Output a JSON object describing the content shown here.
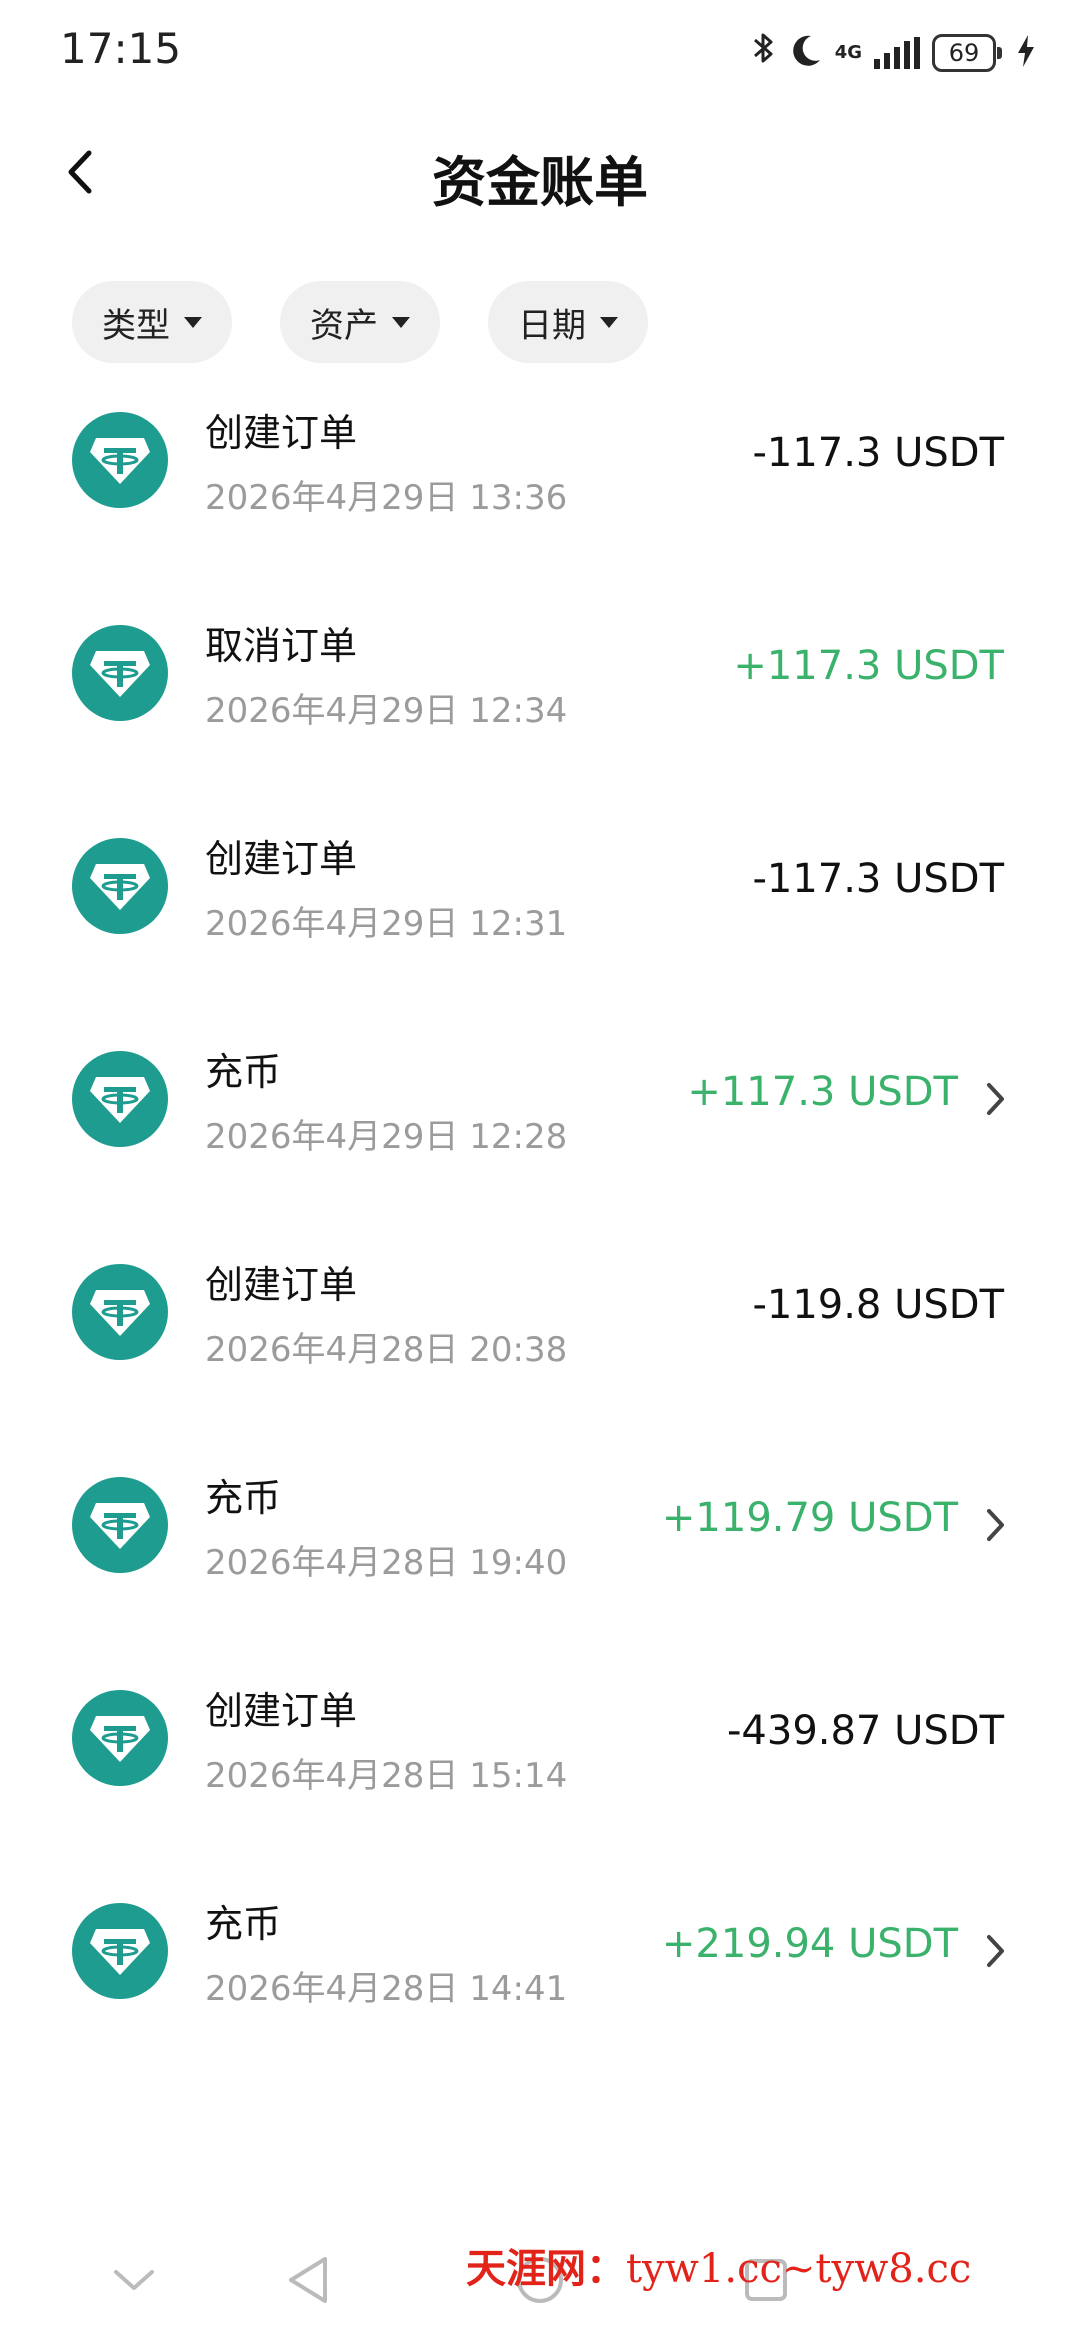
{
  "status_bar": {
    "time": "17:15",
    "network": "4G",
    "battery": "69"
  },
  "header": {
    "title": "资金账单"
  },
  "filters": [
    {
      "label": "类型"
    },
    {
      "label": "资产"
    },
    {
      "label": "日期"
    }
  ],
  "colors": {
    "coin": "#1e9c8f",
    "positive": "#3bb26c",
    "watermark": "#e2231a"
  },
  "transactions": [
    {
      "title": "创建订单",
      "time": "2026年4月29日 13:36",
      "amount": "-117.3 USDT",
      "positive": false,
      "has_detail": false
    },
    {
      "title": "取消订单",
      "time": "2026年4月29日 12:34",
      "amount": "+117.3 USDT",
      "positive": true,
      "has_detail": false
    },
    {
      "title": "创建订单",
      "time": "2026年4月29日 12:31",
      "amount": "-117.3 USDT",
      "positive": false,
      "has_detail": false
    },
    {
      "title": "充币",
      "time": "2026年4月29日 12:28",
      "amount": "+117.3 USDT",
      "positive": true,
      "has_detail": true
    },
    {
      "title": "创建订单",
      "time": "2026年4月28日 20:38",
      "amount": "-119.8 USDT",
      "positive": false,
      "has_detail": false
    },
    {
      "title": "充币",
      "time": "2026年4月28日 19:40",
      "amount": "+119.79 USDT",
      "positive": true,
      "has_detail": true
    },
    {
      "title": "创建订单",
      "time": "2026年4月28日 15:14",
      "amount": "-439.87 USDT",
      "positive": false,
      "has_detail": false
    },
    {
      "title": "充币",
      "time": "2026年4月28日 14:41",
      "amount": "+219.94 USDT",
      "positive": true,
      "has_detail": true
    }
  ],
  "watermark": {
    "site": "天涯网：",
    "urls": "tyw1.cc~tyw8.cc"
  }
}
